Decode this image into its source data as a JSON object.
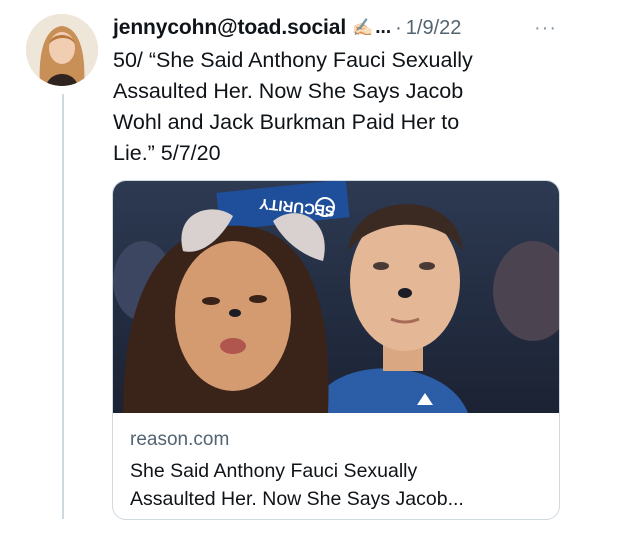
{
  "tweet": {
    "author": "jennycohn@toad.social",
    "author_emoji": "✍🏻",
    "author_truncation": "...",
    "separator": "·",
    "date": "1/9/22",
    "more": "···",
    "text_lines": [
      "50/ “She Said Anthony Fauci Sexually",
      "Assaulted Her. Now She Says Jacob",
      "Wohl and Jack Burkman Paid Her to",
      "Lie.” 5/7/20"
    ]
  },
  "card": {
    "domain": "reason.com",
    "title_lines": [
      "She Said Anthony Fauci Sexually",
      "Assaulted Her. Now She Says Jacob..."
    ],
    "image_sign_text": "SECURITY"
  }
}
